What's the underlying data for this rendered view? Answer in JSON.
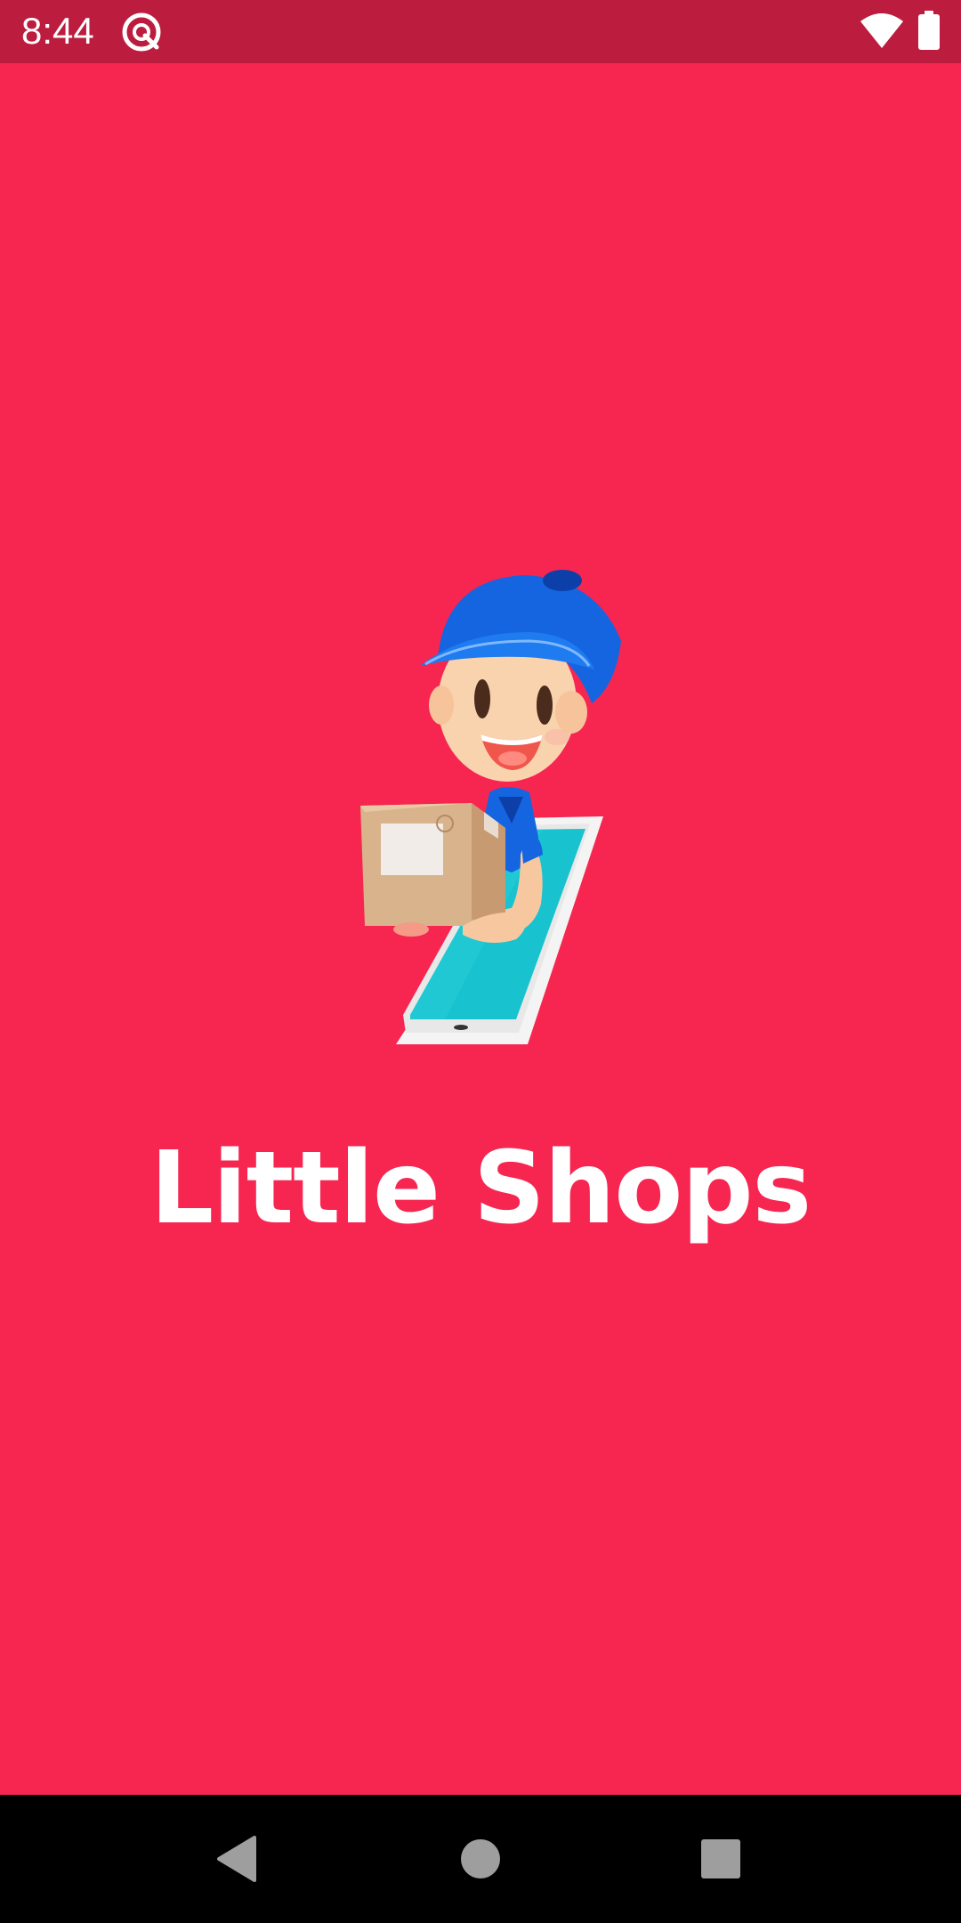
{
  "status_bar": {
    "time": "8:44",
    "app_icon": "q-app-icon",
    "wifi_icon": "wifi-icon",
    "battery_icon": "battery-icon",
    "background_color": "#BC1D3E"
  },
  "splash": {
    "app_name": "Little Shops",
    "background_color": "#F62651",
    "illustration": "delivery-person-with-box-from-phone"
  },
  "nav_bar": {
    "back_icon": "back-triangle-icon",
    "home_icon": "home-circle-icon",
    "recents_icon": "recents-square-icon"
  }
}
